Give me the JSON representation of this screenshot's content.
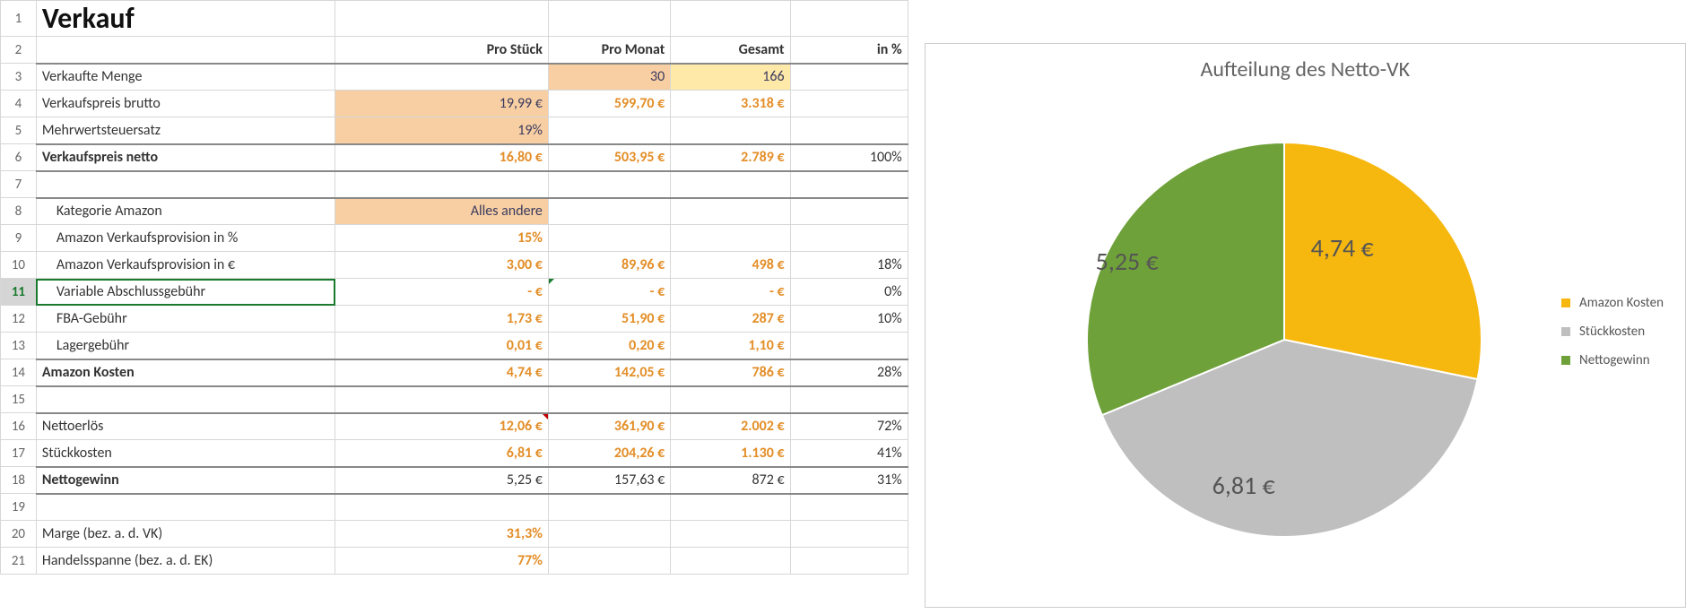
{
  "header": {
    "title": "Verkauf"
  },
  "cols": {
    "b": "Pro Stück",
    "c": "Pro Monat",
    "d": "Gesamt",
    "e": "in %"
  },
  "rows": {
    "r3": {
      "a": "Verkaufte Menge",
      "c": "30",
      "d": "166"
    },
    "r4": {
      "a": "Verkaufspreis brutto",
      "b": "19,99 €",
      "c": "599,70 €",
      "d": "3.318 €"
    },
    "r5": {
      "a": "Mehrwertsteuersatz",
      "b": "19%"
    },
    "r6": {
      "a": "Verkaufspreis netto",
      "b": "16,80 €",
      "c": "503,95 €",
      "d": "2.789 €",
      "e": "100%"
    },
    "r8": {
      "a": "Kategorie Amazon",
      "b": "Alles andere"
    },
    "r9": {
      "a": "Amazon Verkaufsprovision in %",
      "b": "15%"
    },
    "r10": {
      "a": "Amazon Verkaufsprovision in €",
      "b": "3,00 €",
      "c": "89,96 €",
      "d": "498 €",
      "e": "18%"
    },
    "r11": {
      "a": "Variable Abschlussgebühr",
      "b": "-   €",
      "c": "-   €",
      "d": "-   €",
      "e": "0%"
    },
    "r12": {
      "a": "FBA-Gebühr",
      "b": "1,73 €",
      "c": "51,90 €",
      "d": "287 €",
      "e": "10%"
    },
    "r13": {
      "a": "Lagergebühr",
      "b": "0,01 €",
      "c": "0,20 €",
      "d": "1,10 €"
    },
    "r14": {
      "a": "Amazon Kosten",
      "b": "4,74 €",
      "c": "142,05 €",
      "d": "786 €",
      "e": "28%"
    },
    "r16": {
      "a": "Nettoerlös",
      "b": "12,06 €",
      "c": "361,90 €",
      "d": "2.002 €",
      "e": "72%"
    },
    "r17": {
      "a": "Stückkosten",
      "b": "6,81 €",
      "c": "204,26 €",
      "d": "1.130 €",
      "e": "41%"
    },
    "r18": {
      "a": "Nettogewinn",
      "b": "5,25 €",
      "c": "157,63 €",
      "d": "872 €",
      "e": "31%"
    },
    "r20": {
      "a": "Marge (bez. a. d. VK)",
      "b": "31,3%"
    },
    "r21": {
      "a": "Handelsspanne (bez. a. d. EK)",
      "b": "77%"
    }
  },
  "rownums": {
    "1": "1",
    "2": "2",
    "3": "3",
    "4": "4",
    "5": "5",
    "6": "6",
    "7": "7",
    "8": "8",
    "9": "9",
    "10": "10",
    "11": "11",
    "12": "12",
    "13": "13",
    "14": "14",
    "15": "15",
    "16": "16",
    "17": "17",
    "18": "18",
    "19": "19",
    "20": "20",
    "21": "21"
  },
  "chart": {
    "title": "Aufteilung des Netto-VK",
    "legend": {
      "a": "Amazon Kosten",
      "b": "Stückkosten",
      "c": "Nettogewinn"
    },
    "labels": {
      "a": "4,74 €",
      "b": "6,81 €",
      "c": "5,25 €"
    }
  },
  "chart_data": {
    "type": "pie",
    "title": "Aufteilung des Netto-VK",
    "series": [
      {
        "name": "Amazon Kosten",
        "value": 4.74,
        "color": "#f6b70e"
      },
      {
        "name": "Stückkosten",
        "value": 6.81,
        "color": "#bfbfbf"
      },
      {
        "name": "Nettogewinn",
        "value": 5.25,
        "color": "#6fa13a"
      }
    ],
    "value_label_suffix": " €",
    "legend_position": "right"
  }
}
